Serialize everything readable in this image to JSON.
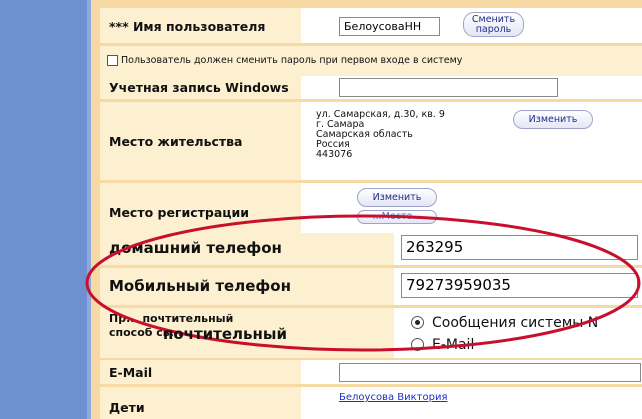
{
  "fields": {
    "username": {
      "label": "*** Имя пользователя",
      "value": "БелоусоваНН",
      "button": "Сменить пароль",
      "button_l1": "Сменить",
      "button_l2": "пароль"
    },
    "must_change": {
      "label": "Пользователь должен сменить пароль при первом входе в систему"
    },
    "windows_account": {
      "label": "Учетная запись Windows",
      "value": ""
    },
    "residence": {
      "label": "Место жительства",
      "address_lines": [
        "ул. Самарская, д.30, кв. 9",
        "г. Самара",
        "Самарская область",
        "Россия",
        "443076"
      ],
      "button": "Изменить"
    },
    "registration": {
      "label": "Место регистрации",
      "button": "Изменить",
      "button2": "...Место..."
    },
    "home_phone": {
      "label": "домашний телефон",
      "value": "263295"
    },
    "mobile_phone": {
      "label": "Мобильный телефон",
      "value": "79273959035"
    },
    "preferred": {
      "label_l1": "Пр... почтительный",
      "label_l2": "способ св...",
      "label_overlay": "почтительный",
      "options": [
        "Сообщения системы N",
        "E-Mail"
      ]
    },
    "email": {
      "label": "E-Mail",
      "value": ""
    },
    "children": {
      "label": "Дети",
      "link": "Белоусова Виктория"
    }
  },
  "colors": {
    "sidebar": "#6e8fd0",
    "frame": "#f6d9a3",
    "label_bg": "#fdf0d0",
    "ellipse": "#c8102e"
  }
}
